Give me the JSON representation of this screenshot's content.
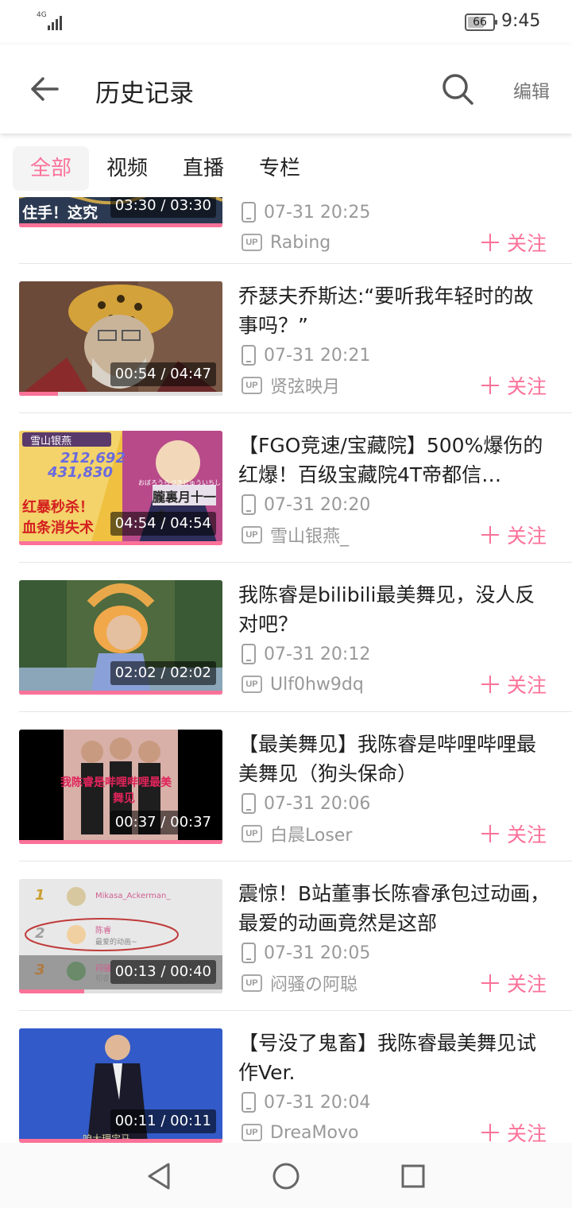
{
  "status_bar": {
    "network": "4G",
    "battery": "66",
    "battery_level": 0.66,
    "time": "9:45"
  },
  "header": {
    "title": "历史记录",
    "edit_label": "编辑"
  },
  "tabs": [
    {
      "label": "全部",
      "active": true
    },
    {
      "label": "视频",
      "active": false
    },
    {
      "label": "直播",
      "active": false
    },
    {
      "label": "专栏",
      "active": false
    }
  ],
  "items": [
    {
      "title": "",
      "time": "07-31 20:25",
      "up": "Rabing",
      "duration": "03:30 / 03:30",
      "progress": 1.0,
      "follow": "关注"
    },
    {
      "title": "乔瑟夫乔斯达:“要听我年轻时的故事吗？”",
      "time": "07-31 20:21",
      "up": "贤弦映月",
      "duration": "00:54 / 04:47",
      "progress": 0.19,
      "follow": "关注"
    },
    {
      "title": "【FGO竞速/宝藏院】500%爆伤的红爆！百级宝藏院4T帝都信…",
      "time": "07-31 20:20",
      "up": "雪山银燕_",
      "duration": "04:54 / 04:54",
      "progress": 1.0,
      "follow": "关注"
    },
    {
      "title": "我陈睿是bilibili最美舞见，没人反对吧？",
      "time": "07-31 20:12",
      "up": "Ulf0hw9dq",
      "duration": "02:02 / 02:02",
      "progress": 1.0,
      "follow": "关注"
    },
    {
      "title": "【最美舞见】我陈睿是哔哩哔哩最美舞见（狗头保命）",
      "time": "07-31 20:06",
      "up": "白晨Loser",
      "duration": "00:37 / 00:37",
      "progress": 1.0,
      "follow": "关注"
    },
    {
      "title": "震惊！B站董事长陈睿承包过动画，最爱的动画竟然是这部",
      "time": "07-31 20:05",
      "up": "闷骚の阿聪",
      "duration": "00:13 / 00:40",
      "progress": 0.32,
      "follow": "关注"
    },
    {
      "title": "【号没了鬼畜】我陈睿最美舞见试作Ver.",
      "time": "07-31 20:04",
      "up": "DreaMovo",
      "duration": "00:11 / 00:11",
      "progress": 1.0,
      "follow": "关注"
    }
  ],
  "thumb_texts": {
    "t0": "住手！这究",
    "t2_tag": "雪山银燕",
    "t2_num1": "212,692",
    "t2_num2": "431,830",
    "t2_red1": "红暴秒杀！",
    "t2_red2": "血条消失术",
    "t2_sub": "おぼろうらづきじゅういちしき",
    "t2_big": "朧裏月十一式",
    "t4_red": "我陈睿是哔哩哔哩最美",
    "t4_red2": "舞见",
    "t5_n1": "1",
    "t5_n2": "2",
    "t5_n3": "3",
    "t5_u1": "Mikasa_Ackerman_",
    "t5_u2": "陈睿",
    "t5_u2b": "最爱的动画~",
    "t5_u3": "闷骚",
    "t5_u3b": "和睿",
    "t6_sub": "咱大理宝马"
  },
  "colors": {
    "accent": "#fb7299",
    "meta": "#999999"
  }
}
